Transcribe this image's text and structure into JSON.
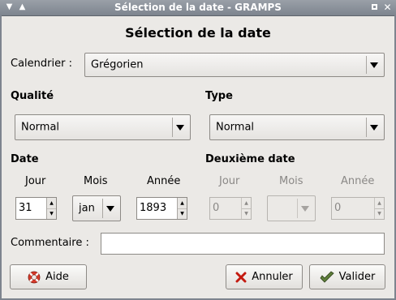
{
  "window": {
    "title": "Sélection de la date - GRAMPS",
    "icons": {
      "menu": "window-menu-icon",
      "shade": "shade-icon",
      "maximize": "maximize-icon",
      "close": "close-icon"
    }
  },
  "heading": "Sélection de la date",
  "calendar": {
    "label": "Calendrier :",
    "value": "Grégorien"
  },
  "quality": {
    "label": "Qualité",
    "value": "Normal"
  },
  "type": {
    "label": "Type",
    "value": "Normal"
  },
  "date": {
    "label": "Date",
    "day": {
      "label": "Jour",
      "value": "31"
    },
    "month": {
      "label": "Mois",
      "value": "jan"
    },
    "year": {
      "label": "Année",
      "value": "1893"
    }
  },
  "second_date": {
    "label": "Deuxième date",
    "day": {
      "label": "Jour",
      "value": "0"
    },
    "month": {
      "label": "Mois",
      "value": ""
    },
    "year": {
      "label": "Année",
      "value": "0"
    }
  },
  "comment": {
    "label": "Commentaire :",
    "value": ""
  },
  "buttons": {
    "help": {
      "label": "Aide",
      "icon": "lifebuoy-icon"
    },
    "cancel": {
      "label": "Annuler",
      "icon": "red-x-icon"
    },
    "ok": {
      "label": "Valider",
      "icon": "checkmark-icon"
    }
  }
}
